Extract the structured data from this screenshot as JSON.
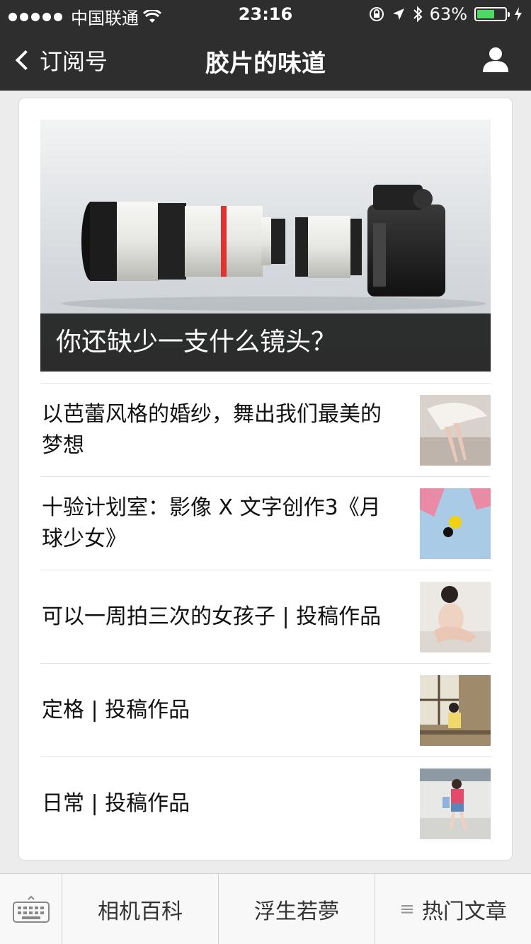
{
  "status": {
    "carrier": "中国联通",
    "time": "23:16",
    "battery": "63%",
    "battery_level": 0.63,
    "battery_color": "#4cd964"
  },
  "nav": {
    "back_label": "订阅号",
    "title": "胶片的味道",
    "profile_icon": "person-icon"
  },
  "cover": {
    "title": "你还缺少一支什么镜头？"
  },
  "articles": [
    {
      "title": "以芭蕾风格的婚纱，舞出我们最美的梦想"
    },
    {
      "title": "十验计划室：影像 X 文字创作3《月球少女》"
    },
    {
      "title": "可以一周拍三次的女孩子 | 投稿作品"
    },
    {
      "title": "定格 | 投稿作品"
    },
    {
      "title": "日常 | 投稿作品"
    }
  ],
  "tabbar": {
    "keyboard_icon": "keyboard-icon",
    "tabs": [
      {
        "label": "相机百科"
      },
      {
        "label": "浮生若夢"
      },
      {
        "label": "热门文章",
        "icon": "menu-icon"
      }
    ]
  }
}
